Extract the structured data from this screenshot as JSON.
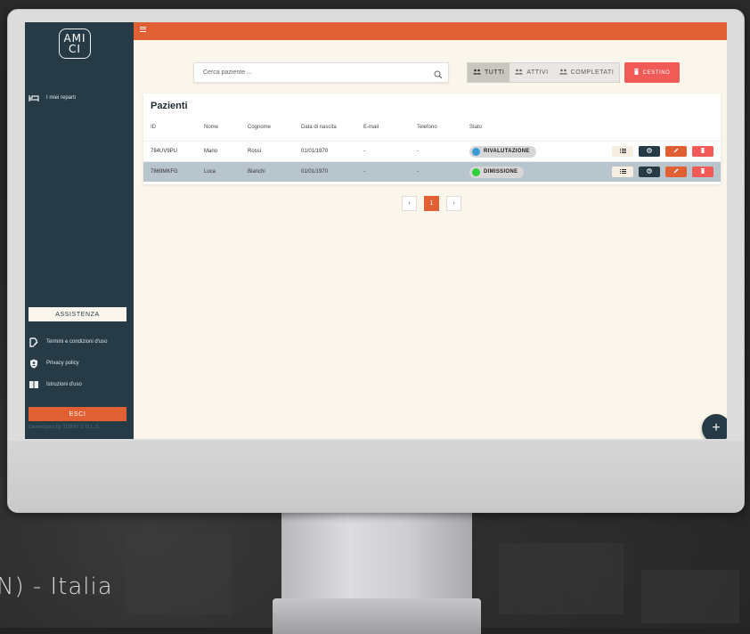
{
  "app": {
    "logo_line1": "AMI",
    "logo_line2": "CI"
  },
  "sidebar": {
    "items": [
      {
        "label": "I miei reparti",
        "icon": "bed-icon"
      }
    ],
    "assist_label": "ASSISTENZA",
    "links": [
      {
        "label": "Termini e condizioni d'uso",
        "icon": "document-edit-icon"
      },
      {
        "label": "Privacy policy",
        "icon": "shield-user-icon"
      },
      {
        "label": "Istruzioni d'uso",
        "icon": "book-icon"
      }
    ],
    "exit_label": "ESCI",
    "credits": "Developed by TOBIH S.R.L.S."
  },
  "search": {
    "placeholder": "Cerca paziente ...",
    "value": ""
  },
  "filters": [
    {
      "label": "TUTTI",
      "active": true
    },
    {
      "label": "ATTIVI",
      "active": false
    },
    {
      "label": "COMPLETATI",
      "active": false
    }
  ],
  "trash_label": "CESTINO",
  "table": {
    "title": "Pazienti",
    "columns": [
      "ID",
      "Nome",
      "Cognome",
      "Data di nascita",
      "E-mail",
      "Telefono",
      "Stato"
    ],
    "rows": [
      {
        "id": "784UV9PU",
        "nome": "Mario",
        "cognome": "Rossi",
        "nascita": "01/01/1970",
        "email": "-",
        "telefono": "-",
        "stato": "RIVALUTAZIONE",
        "stato_color": "#3a9ad9",
        "selected": false
      },
      {
        "id": "7869MKFG",
        "nome": "Luca",
        "cognome": "Bianchi",
        "nascita": "01/01/1970",
        "email": "-",
        "telefono": "-",
        "stato": "DIMISSIONE",
        "stato_color": "#2fd03a",
        "selected": true
      }
    ]
  },
  "pagination": {
    "prev": "‹",
    "current": "1",
    "next": "›"
  },
  "fab_label": "+",
  "background_text": "N) - Italia",
  "colors": {
    "accent": "#e06033",
    "sidebar": "#263b46",
    "danger": "#f05a57",
    "content_bg": "#fbf6ec"
  }
}
